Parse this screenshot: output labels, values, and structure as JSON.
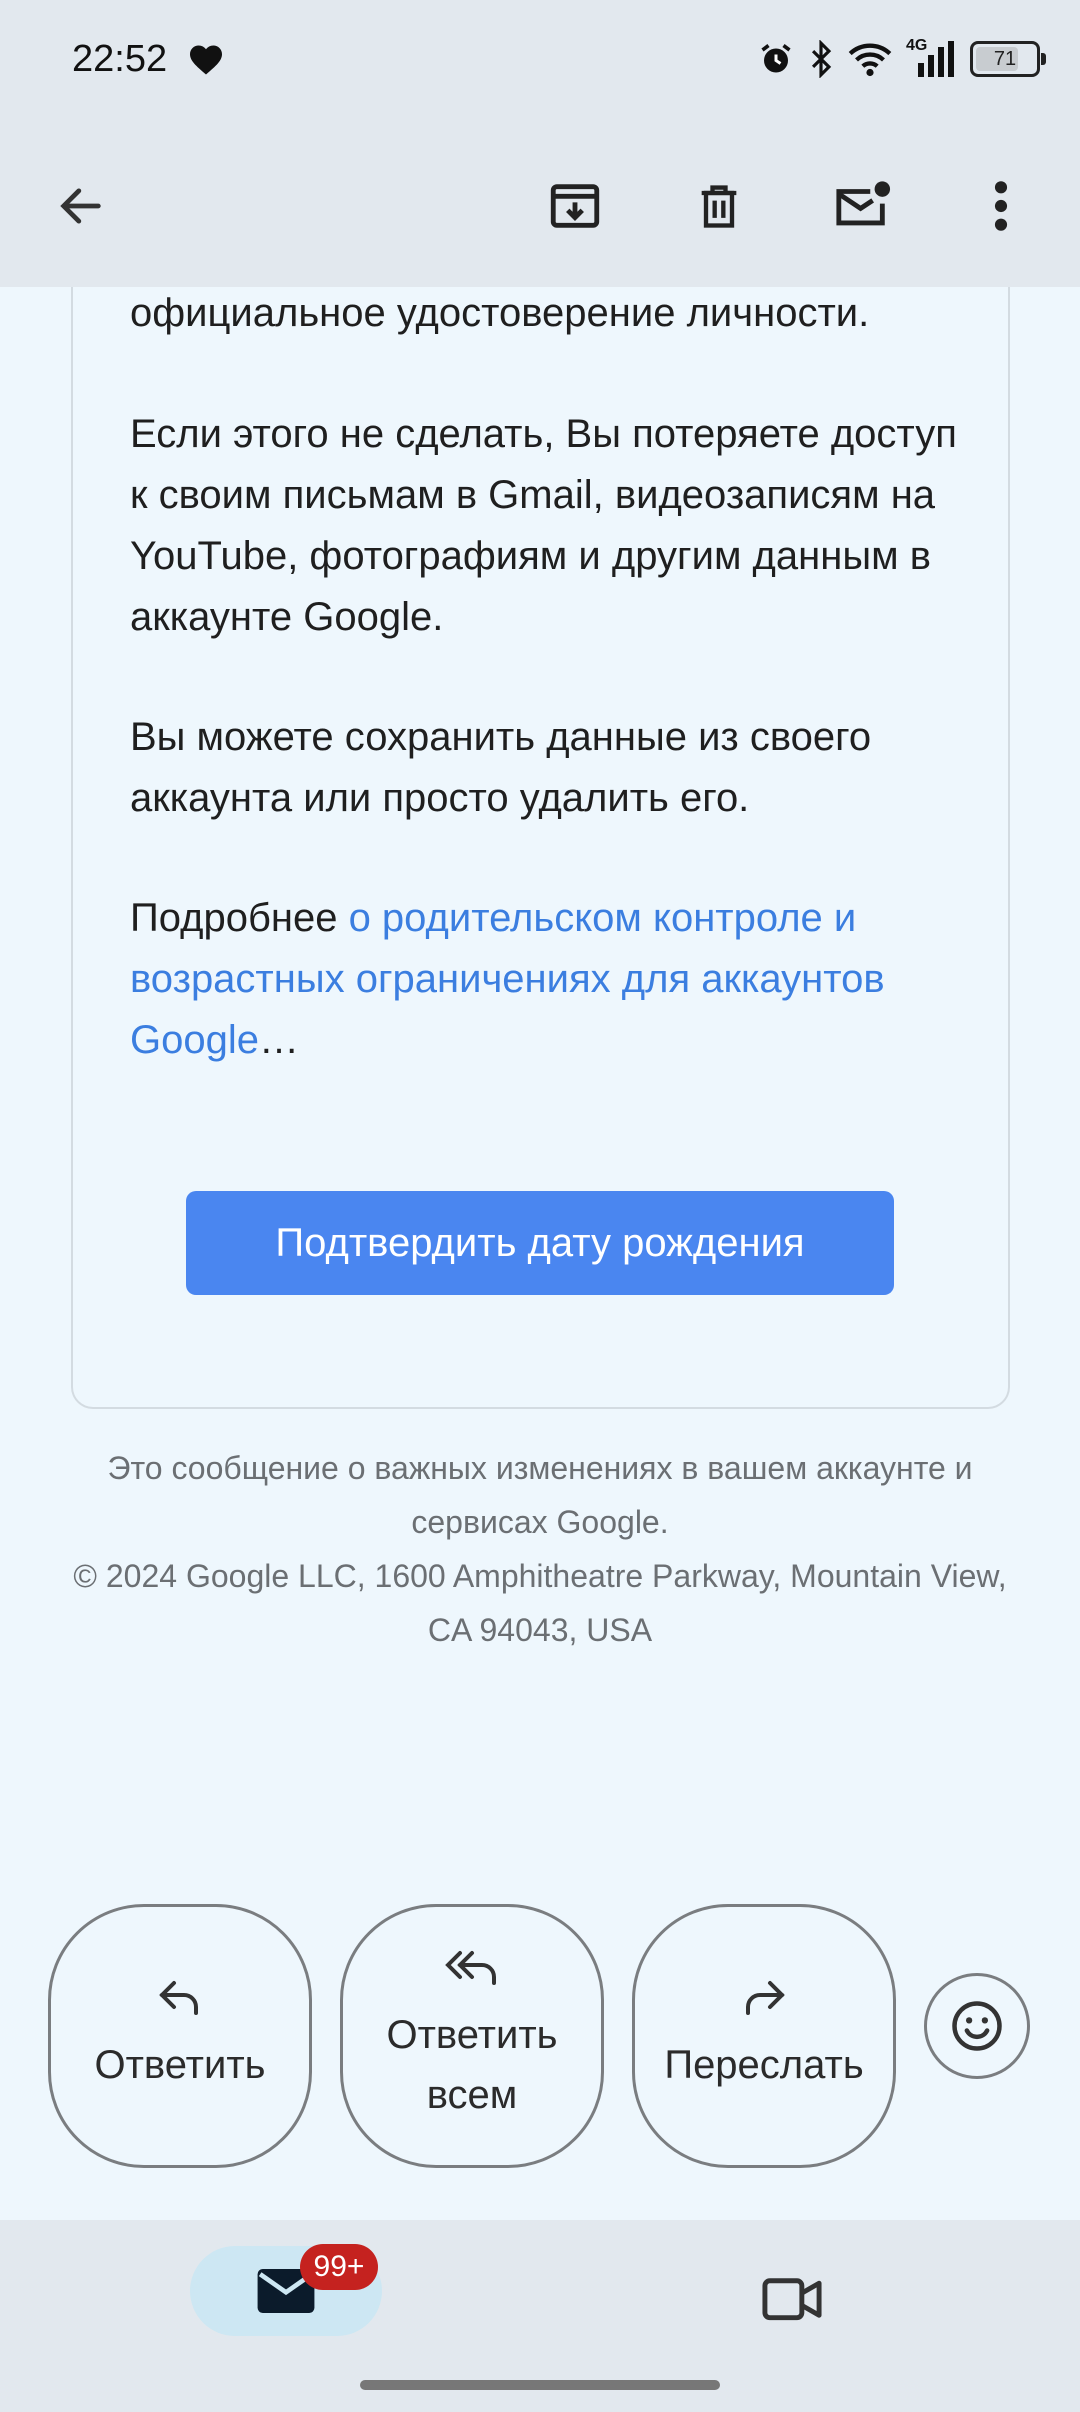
{
  "status_bar": {
    "time": "22:52",
    "battery": "71",
    "network": "4G"
  },
  "toolbar": {
    "icons": [
      "back-arrow-icon",
      "archive-icon",
      "delete-icon",
      "mark-unread-icon",
      "more-vert-icon"
    ]
  },
  "email": {
    "paragraphs": [
      "официальное удостоверение личности.",
      "Если этого не сделать, Вы потеряете доступ к своим письмам в Gmail, видеозаписям на YouTube, фотографиям и другим данным в аккаунте Google.",
      "Вы можете сохранить данные из своего аккаунта или просто удалить его."
    ],
    "more_prefix": "Подробнее ",
    "more_link": "о родительском контроле и возрастных ограничениях для аккаунтов Google",
    "more_suffix": "…",
    "cta_label": "Подтвердить дату рождения"
  },
  "footer": {
    "line1": "Это сообщение о важных изменениях в вашем аккаунте и сервисах Google.",
    "line2": "© 2024 Google LLC, 1600 Amphitheatre Parkway, Mountain View, CA 94043, USA"
  },
  "actions": {
    "reply": "Ответить",
    "reply_all": "Ответить всем",
    "forward": "Переслать"
  },
  "bottom_nav": {
    "mail_badge": "99+"
  },
  "colors": {
    "accent": "#4a86f0",
    "link": "#3b7ee0",
    "badge": "#c5221f",
    "bar_bg": "#e2e8ee",
    "page_bg": "#eef7fd"
  }
}
